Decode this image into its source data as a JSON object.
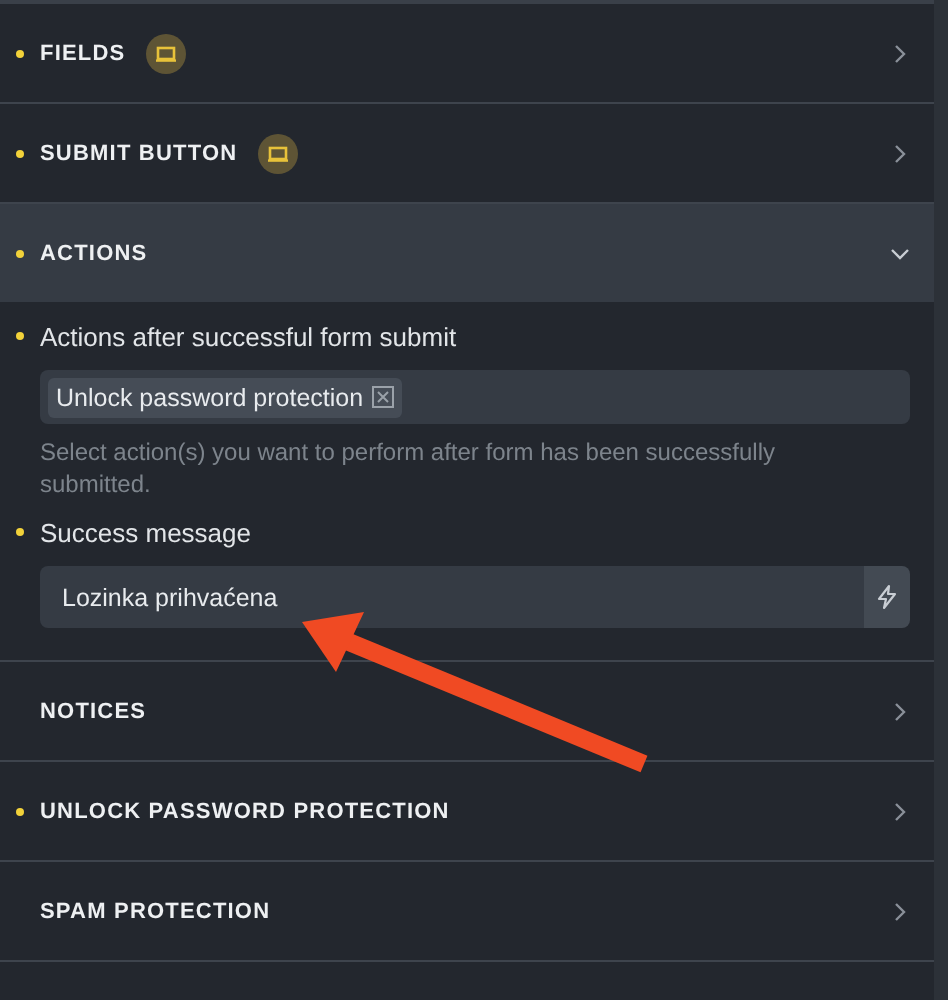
{
  "sections": [
    {
      "title": "FIELDS",
      "modified": true,
      "badge": true,
      "expanded": false
    },
    {
      "title": "SUBMIT BUTTON",
      "modified": true,
      "badge": true,
      "expanded": false
    },
    {
      "title": "ACTIONS",
      "modified": true,
      "badge": false,
      "expanded": true,
      "controls": [
        {
          "kind": "multiselect",
          "label": "Actions after successful form submit",
          "modified": true,
          "tags": [
            "Unlock password protection"
          ],
          "description": "Select action(s) you want to perform after form has been successfully submitted."
        },
        {
          "kind": "text",
          "label": "Success message",
          "modified": true,
          "value": "Lozinka prihvaćena"
        }
      ]
    },
    {
      "title": "NOTICES",
      "modified": false,
      "badge": false,
      "expanded": false
    },
    {
      "title": "UNLOCK PASSWORD PROTECTION",
      "modified": true,
      "badge": false,
      "expanded": false
    },
    {
      "title": "SPAM PROTECTION",
      "modified": false,
      "badge": false,
      "expanded": false
    }
  ]
}
